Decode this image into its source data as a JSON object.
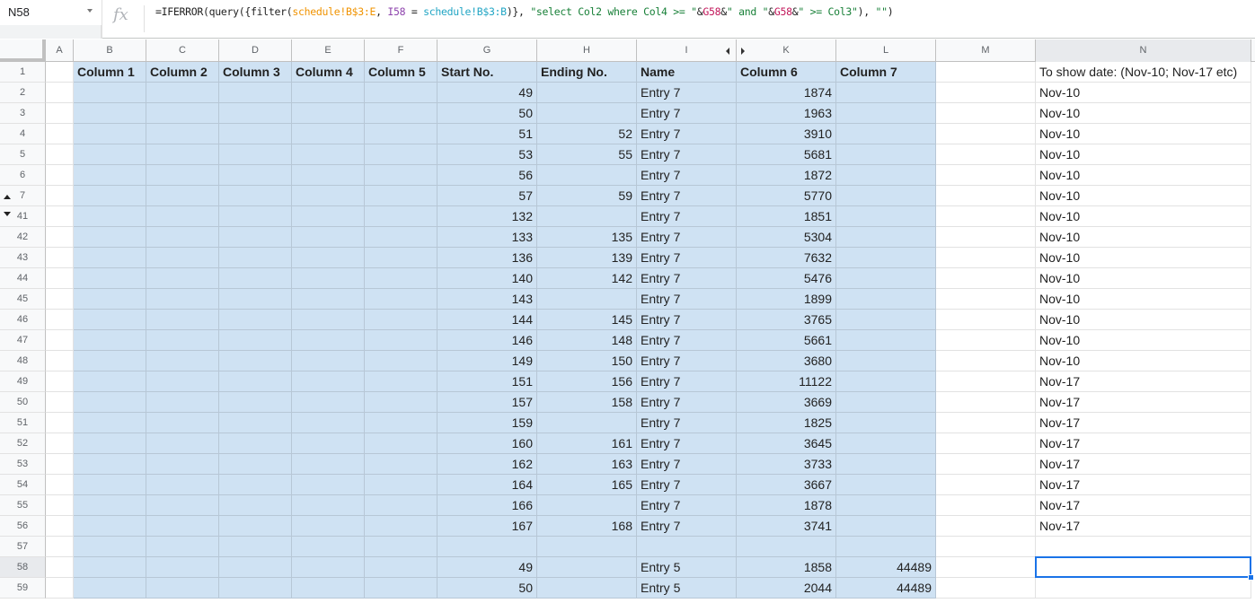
{
  "name_box": "N58",
  "formula": {
    "parts": [
      {
        "text": "=IFERROR(query({filter(",
        "color": "default"
      },
      {
        "text": "schedule!B$3:E",
        "color": "orange"
      },
      {
        "text": ", ",
        "color": "default"
      },
      {
        "text": "I58",
        "color": "purple"
      },
      {
        "text": " = ",
        "color": "default"
      },
      {
        "text": "schedule!B$3:B",
        "color": "teal"
      },
      {
        "text": ")}, ",
        "color": "default"
      },
      {
        "text": "\"select Col2 where Col4 >= \"",
        "color": "green"
      },
      {
        "text": "&",
        "color": "default"
      },
      {
        "text": "G58",
        "color": "red"
      },
      {
        "text": "&",
        "color": "default"
      },
      {
        "text": "\" and \"",
        "color": "green"
      },
      {
        "text": "&",
        "color": "default"
      },
      {
        "text": "G58",
        "color": "red"
      },
      {
        "text": "&",
        "color": "default"
      },
      {
        "text": "\" >= Col3\"",
        "color": "green"
      },
      {
        "text": "), ",
        "color": "default"
      },
      {
        "text": "\"\"",
        "color": "green"
      },
      {
        "text": ")",
        "color": "default"
      }
    ]
  },
  "columns": [
    "A",
    "B",
    "C",
    "D",
    "E",
    "F",
    "G",
    "H",
    "I",
    "K",
    "L",
    "M",
    "N"
  ],
  "selected_column": "N",
  "selected_row": "58",
  "rows": [
    {
      "num": "1",
      "group": "",
      "cells": {
        "B": "Column 1",
        "C": "Column 2",
        "D": "Column 3",
        "E": "Column 4",
        "F": "Column 5",
        "G": "Start No.",
        "H": "Ending No.",
        "I": "Name",
        "K": "Column 6",
        "L": "Column 7",
        "N": "To show date: (Nov-10; Nov-17 etc)"
      }
    },
    {
      "num": "2",
      "cells": {
        "G": "49",
        "H": "",
        "I": "Entry 7",
        "K": "1874",
        "L": "",
        "N": "Nov-10"
      }
    },
    {
      "num": "3",
      "cells": {
        "G": "50",
        "H": "",
        "I": "Entry 7",
        "K": "1963",
        "L": "",
        "N": "Nov-10"
      }
    },
    {
      "num": "4",
      "cells": {
        "G": "51",
        "H": "52",
        "I": "Entry 7",
        "K": "3910",
        "L": "",
        "N": "Nov-10"
      }
    },
    {
      "num": "5",
      "cells": {
        "G": "53",
        "H": "55",
        "I": "Entry 7",
        "K": "5681",
        "L": "",
        "N": "Nov-10"
      }
    },
    {
      "num": "6",
      "cells": {
        "G": "56",
        "H": "",
        "I": "Entry 7",
        "K": "1872",
        "L": "",
        "N": "Nov-10"
      }
    },
    {
      "num": "7",
      "group": "up",
      "cells": {
        "G": "57",
        "H": "59",
        "I": "Entry 7",
        "K": "5770",
        "L": "",
        "N": "Nov-10"
      }
    },
    {
      "num": "41",
      "group": "down",
      "cells": {
        "G": "132",
        "H": "",
        "I": "Entry 7",
        "K": "1851",
        "L": "",
        "N": "Nov-10"
      }
    },
    {
      "num": "42",
      "cells": {
        "G": "133",
        "H": "135",
        "I": "Entry 7",
        "K": "5304",
        "L": "",
        "N": "Nov-10"
      }
    },
    {
      "num": "43",
      "cells": {
        "G": "136",
        "H": "139",
        "I": "Entry 7",
        "K": "7632",
        "L": "",
        "N": "Nov-10"
      }
    },
    {
      "num": "44",
      "cells": {
        "G": "140",
        "H": "142",
        "I": "Entry 7",
        "K": "5476",
        "L": "",
        "N": "Nov-10"
      }
    },
    {
      "num": "45",
      "cells": {
        "G": "143",
        "H": "",
        "I": "Entry 7",
        "K": "1899",
        "L": "",
        "N": "Nov-10"
      }
    },
    {
      "num": "46",
      "cells": {
        "G": "144",
        "H": "145",
        "I": "Entry 7",
        "K": "3765",
        "L": "",
        "N": "Nov-10"
      }
    },
    {
      "num": "47",
      "cells": {
        "G": "146",
        "H": "148",
        "I": "Entry 7",
        "K": "5661",
        "L": "",
        "N": "Nov-10"
      }
    },
    {
      "num": "48",
      "cells": {
        "G": "149",
        "H": "150",
        "I": "Entry 7",
        "K": "3680",
        "L": "",
        "N": "Nov-10"
      }
    },
    {
      "num": "49",
      "cells": {
        "G": "151",
        "H": "156",
        "I": "Entry 7",
        "K": "11122",
        "L": "",
        "N": "Nov-17"
      }
    },
    {
      "num": "50",
      "cells": {
        "G": "157",
        "H": "158",
        "I": "Entry 7",
        "K": "3669",
        "L": "",
        "N": "Nov-17"
      }
    },
    {
      "num": "51",
      "cells": {
        "G": "159",
        "H": "",
        "I": "Entry 7",
        "K": "1825",
        "L": "",
        "N": "Nov-17"
      }
    },
    {
      "num": "52",
      "cells": {
        "G": "160",
        "H": "161",
        "I": "Entry 7",
        "K": "3645",
        "L": "",
        "N": "Nov-17"
      }
    },
    {
      "num": "53",
      "cells": {
        "G": "162",
        "H": "163",
        "I": "Entry 7",
        "K": "3733",
        "L": "",
        "N": "Nov-17"
      }
    },
    {
      "num": "54",
      "cells": {
        "G": "164",
        "H": "165",
        "I": "Entry 7",
        "K": "3667",
        "L": "",
        "N": "Nov-17"
      }
    },
    {
      "num": "55",
      "cells": {
        "G": "166",
        "H": "",
        "I": "Entry 7",
        "K": "1878",
        "L": "",
        "N": "Nov-17"
      }
    },
    {
      "num": "56",
      "cells": {
        "G": "167",
        "H": "168",
        "I": "Entry 7",
        "K": "3741",
        "L": "",
        "N": "Nov-17"
      }
    },
    {
      "num": "57",
      "cells": {}
    },
    {
      "num": "58",
      "cells": {
        "G": "49",
        "H": "",
        "I": "Entry 5",
        "K": "1858",
        "L": "44489",
        "N": ""
      }
    },
    {
      "num": "59",
      "cells": {
        "G": "50",
        "H": "",
        "I": "Entry 5",
        "K": "2044",
        "L": "44489",
        "N": ""
      }
    }
  ],
  "colors": {
    "selection": "#1a73e8",
    "highlight_fill": "#cfe2f3"
  }
}
